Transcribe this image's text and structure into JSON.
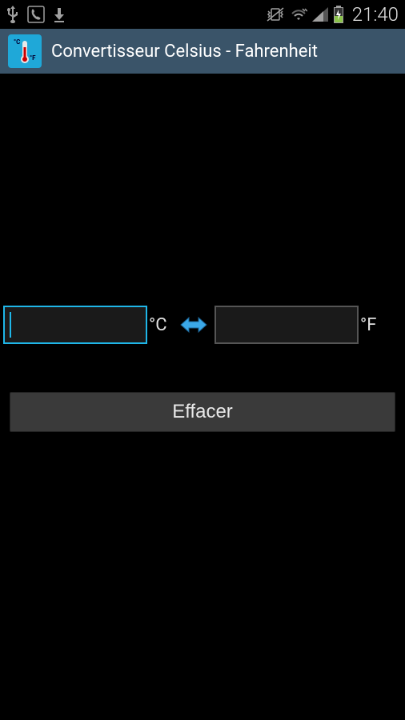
{
  "status_bar": {
    "clock": "21:40"
  },
  "app_bar": {
    "title": "Convertisseur Celsius - Fahrenheit"
  },
  "converter": {
    "celsius_value": "",
    "celsius_unit": "°C",
    "fahrenheit_value": "",
    "fahrenheit_unit": "°F"
  },
  "button": {
    "clear_label": "Effacer"
  }
}
